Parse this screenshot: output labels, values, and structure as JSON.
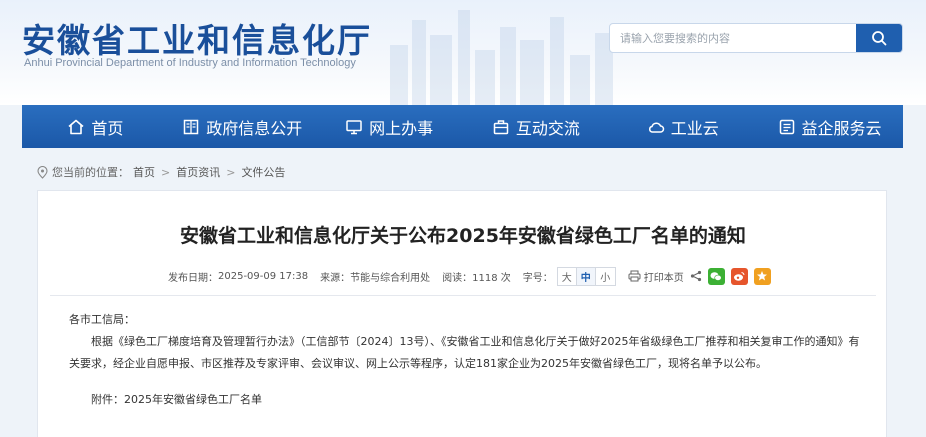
{
  "header": {
    "title": "安徽省工业和信息化厅",
    "subtitle": "Anhui Provincial Department of Industry and Information Technology",
    "search_placeholder": "请输入您要搜索的内容"
  },
  "nav": {
    "items": [
      {
        "label": "首页",
        "icon": "home-icon"
      },
      {
        "label": "政府信息公开",
        "icon": "document-icon"
      },
      {
        "label": "网上办事",
        "icon": "monitor-icon"
      },
      {
        "label": "互动交流",
        "icon": "briefcase-icon"
      },
      {
        "label": "工业云",
        "icon": "cloud-icon"
      },
      {
        "label": "益企服务云",
        "icon": "list-icon"
      }
    ]
  },
  "breadcrumb": {
    "prefix": "您当前的位置：",
    "items": [
      "首页",
      "首页资讯",
      "文件公告"
    ],
    "separator": ">"
  },
  "article": {
    "title": "安徽省工业和信息化厅关于公布2025年安徽省绿色工厂名单的通知",
    "meta": {
      "date_label": "发布日期：",
      "date": "2025-09-09 17:38",
      "source_label": "来源：",
      "source": "节能与综合利用处",
      "views_label": "阅读：",
      "views": "1118 次",
      "font_label": "字号：",
      "font_sizes": [
        "大",
        "中",
        "小"
      ],
      "print_label": "打印本页"
    },
    "salutation": "各市工信局：",
    "paragraph": "根据《绿色工厂梯度培育及管理暂行办法》（工信部节〔2024〕13号）、《安徽省工业和信息化厅关于做好2025年省级绿色工厂推荐和相关复审工作的通知》有关要求，经企业自愿申报、市区推荐及专家评审、会议审议、网上公示等程序，认定181家企业为2025年安徽省绿色工厂，现将名单予以公布。",
    "attachment": "附件：2025年安徽省绿色工厂名单"
  },
  "colors": {
    "brand": "#1a4f9a",
    "nav": "#1f5faf",
    "wechat": "#3cb034",
    "weibo": "#e6552c",
    "favorite": "#f0a020"
  }
}
